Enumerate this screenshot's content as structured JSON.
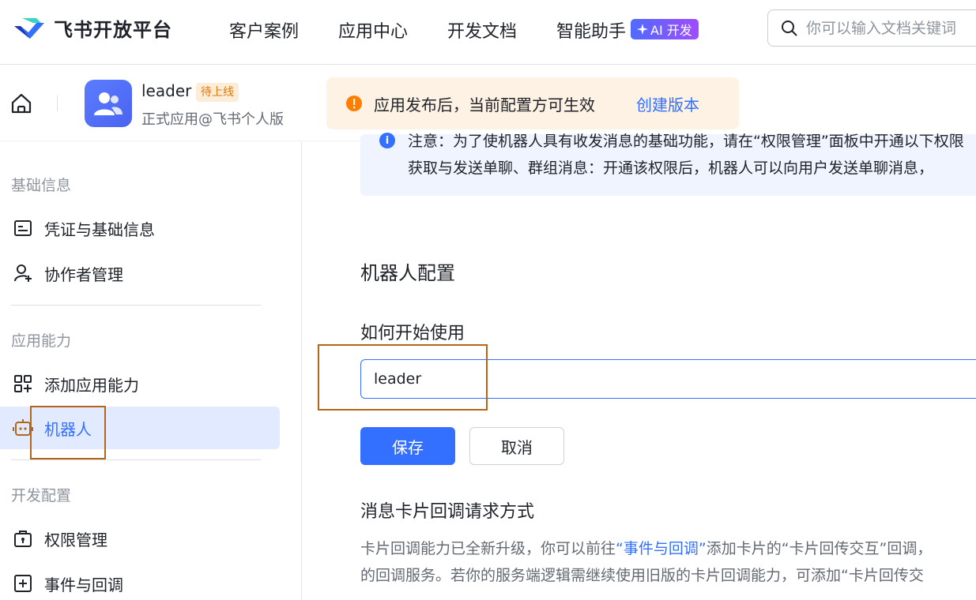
{
  "topnav": {
    "brand": "飞书开放平台",
    "items": [
      "客户案例",
      "应用中心",
      "开发文档",
      "智能助手"
    ],
    "ai_badge": "AI 开发",
    "search_placeholder": "你可以输入文档关键词"
  },
  "app": {
    "name": "leader",
    "status": "待上线",
    "subtitle": "正式应用@飞书个人版"
  },
  "notice": {
    "text": "应用发布后，当前配置方可生效",
    "link": "创建版本"
  },
  "sidebar": {
    "groups": [
      "基础信息",
      "应用能力",
      "开发配置"
    ],
    "items": [
      {
        "label": "凭证与基础信息",
        "icon": "credential-icon"
      },
      {
        "label": "协作者管理",
        "icon": "add-user-icon"
      },
      {
        "label": "添加应用能力",
        "icon": "grid-plus-icon"
      },
      {
        "label": "机器人",
        "icon": "robot-icon"
      },
      {
        "label": "权限管理",
        "icon": "briefcase-lock-icon"
      },
      {
        "label": "事件与回调",
        "icon": "plus-square-icon"
      }
    ]
  },
  "main": {
    "info_line1": "注意：为了使机器人具有收发消息的基础功能，请在“权限管理”面板中开通以下权限",
    "info_line2": "获取与发送单聊、群组消息：开通该权限后，机器人可以向用户发送单聊消息，",
    "section_title": "机器人配置",
    "field_label": "如何开始使用",
    "field_value": "leader",
    "save": "保存",
    "cancel": "取消",
    "callback_title": "消息卡片回调请求方式",
    "desc1_a": "卡片回调能力已全新升级，你可以前往",
    "desc1_link": "“事件与回调”",
    "desc1_b": "添加卡片的“卡片回传交互”回调，",
    "desc2": "的回调服务。若你的服务端逻辑需继续使用旧版的卡片回调能力，可添加“卡片回传交"
  },
  "colors": {
    "primary": "#3370ff",
    "active_bg": "#e1eaff",
    "notice_bg": "#fdf2e4",
    "warning": "#ff7d00",
    "status_tag": "#de7802"
  }
}
